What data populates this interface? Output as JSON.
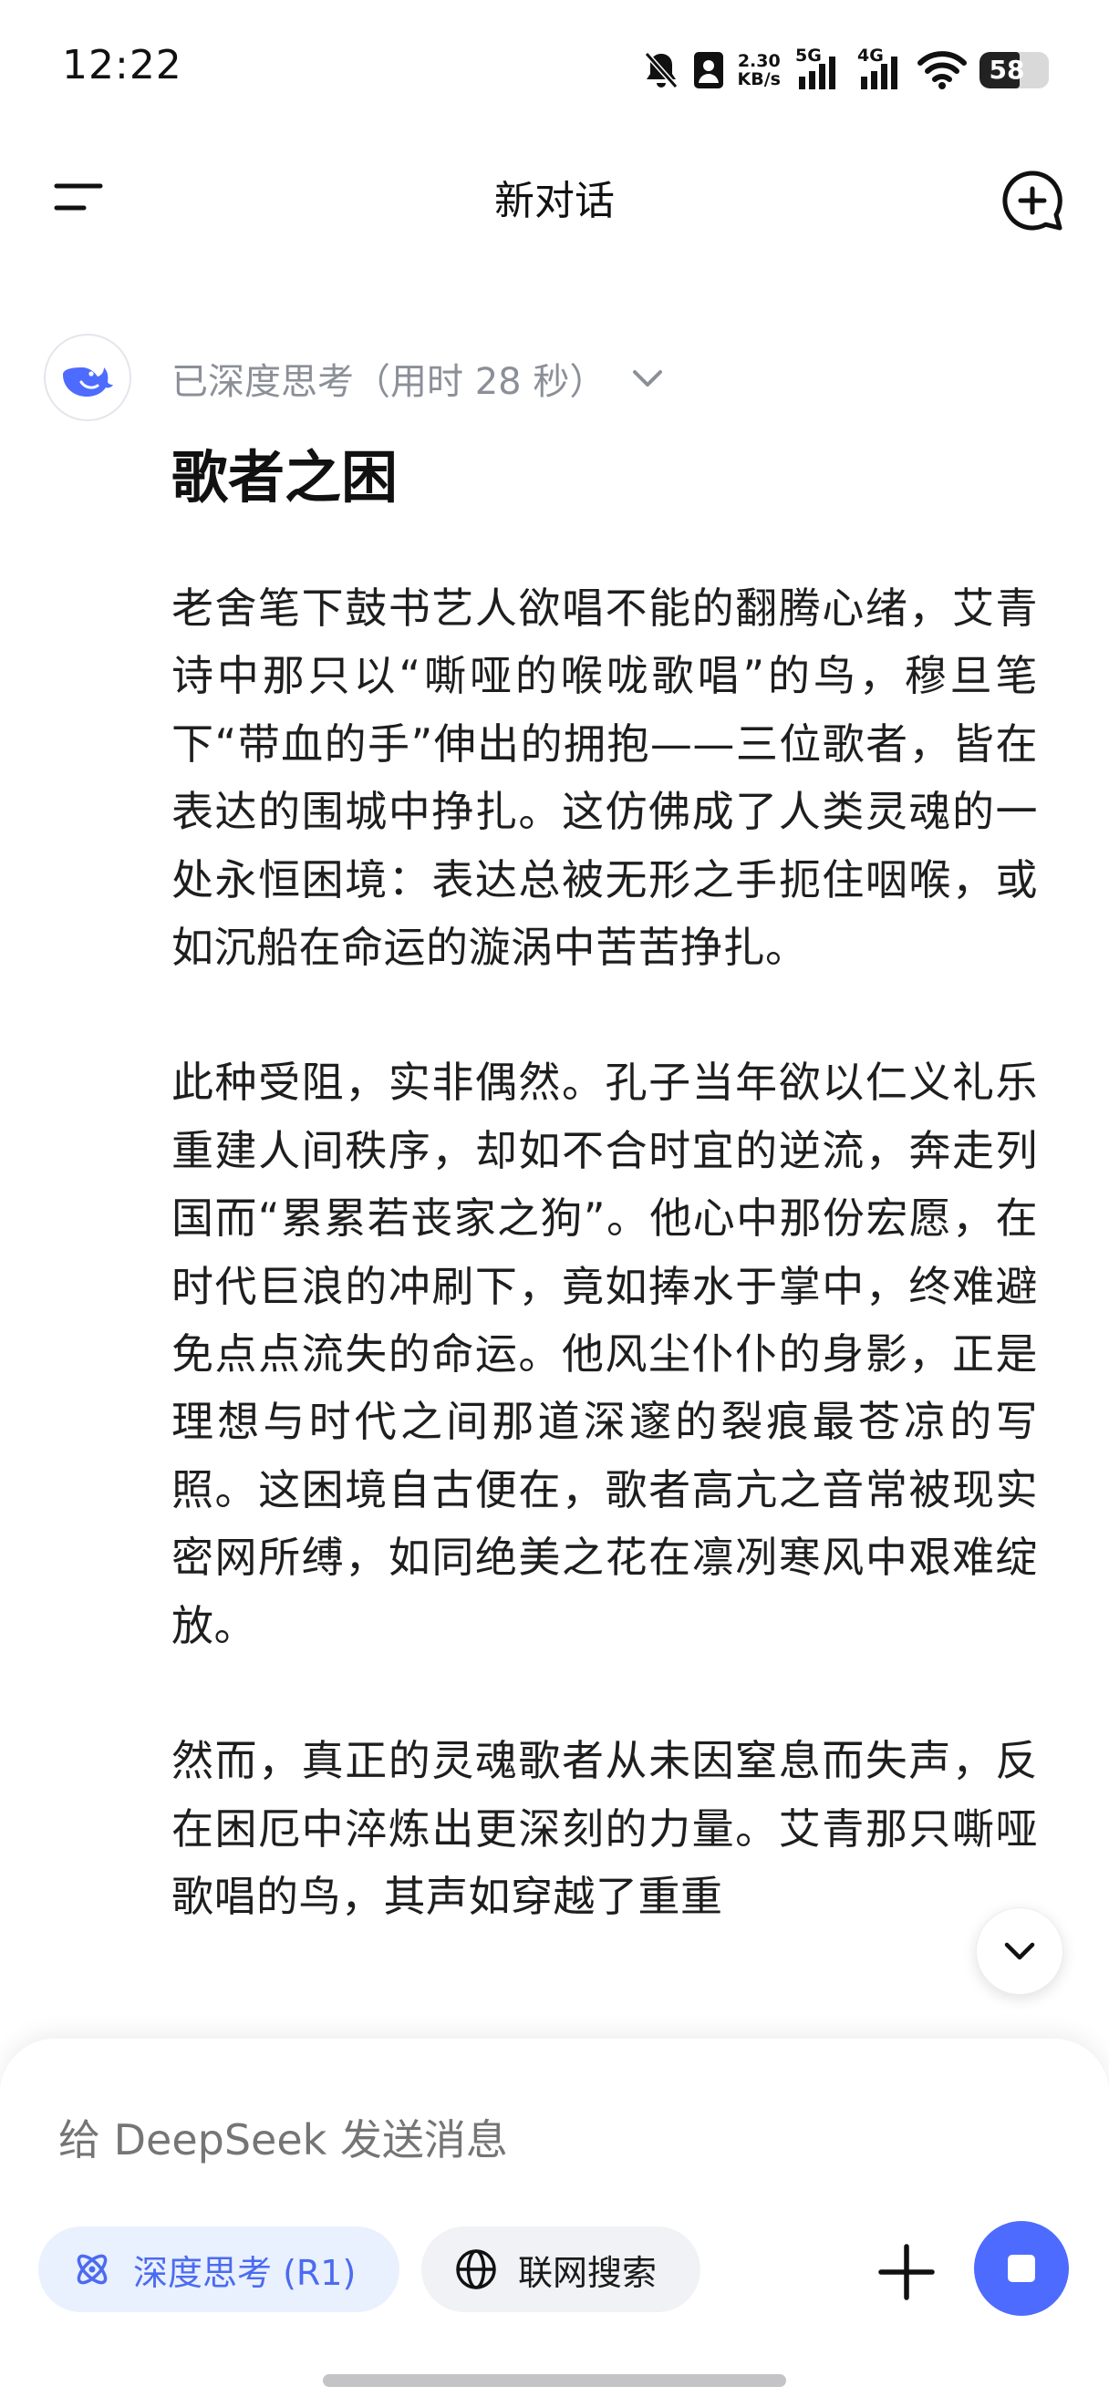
{
  "status_bar": {
    "time": "12:22",
    "net_speed_value": "2.30",
    "net_speed_unit": "KB/s",
    "signal_1": "5G",
    "signal_2": "4G",
    "battery": "58",
    "battery_level": 0.58
  },
  "header": {
    "title": "新对话"
  },
  "message": {
    "thinking_label": "已深度思考（用时 28 秒）",
    "title": "歌者之困",
    "paragraphs": [
      "老舍笔下鼓书艺人欲唱不能的翻腾心绪，艾青诗中那只以“嘶哑的喉咙歌唱”的鸟，穆旦笔下“带血的手”伸出的拥抱——三位歌者，皆在表达的围城中挣扎。这仿佛成了人类灵魂的一处永恒困境：表达总被无形之手扼住咽喉，或如沉船在命运的漩涡中苦苦挣扎。",
      "此种受阻，实非偶然。孔子当年欲以仁义礼乐重建人间秩序，却如不合时宜的逆流，奔走列国而“累累若丧家之狗”。他心中那份宏愿，在时代巨浪的冲刷下，竟如捧水于掌中，终难避免点点流失的命运。他风尘仆仆的身影，正是理想与时代之间那道深邃的裂痕最苍凉的写照。这困境自古便在，歌者高亢之音常被现实密网所缚，如同绝美之花在凛冽寒风中艰难绽放。",
      "然而，真正的灵魂歌者从未因窒息而失声，反在困厄中淬炼出更深刻的力量。艾青那只嘶哑歌唱的鸟，其声如穿越了重重"
    ]
  },
  "composer": {
    "placeholder": "给 DeepSeek 发送消息",
    "deep_think_label": "深度思考 (R1)",
    "web_search_label": "联网搜索"
  },
  "colors": {
    "accent": "#4d6bfe",
    "deep_chip_bg": "#e9f0fe",
    "thinking_text": "#8b8f98"
  },
  "icons": {
    "menu": "menu-icon",
    "new_chat": "new-chat-icon",
    "avatar": "deepseek-whale-icon",
    "expand": "chevron-down-icon",
    "scroll_down": "chevron-down-icon",
    "deep_think": "atom-icon",
    "web_search": "globe-icon",
    "attach": "plus-icon",
    "stop": "stop-icon"
  }
}
